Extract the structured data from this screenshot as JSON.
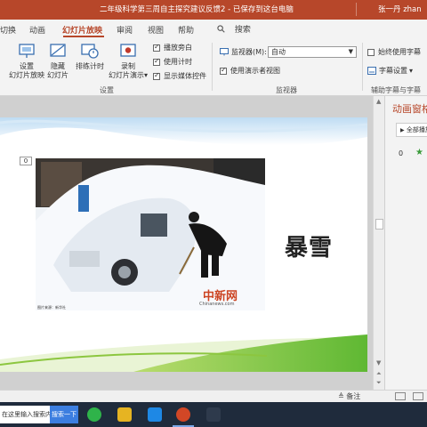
{
  "window": {
    "title": "二年级科学第三周自主探究建议反馈2 - 已保存到这台电脑",
    "user": "张一丹 zhan"
  },
  "tabs": [
    "切换",
    "动画",
    "幻灯片放映",
    "审阅",
    "视图",
    "帮助"
  ],
  "active_tab": "幻灯片放映",
  "search_label": "搜索",
  "ribbon": {
    "setup_slideshow": "设置\n幻灯片放映",
    "hide_slide": "隐藏\n幻灯片",
    "rehearse_timings": "排练计时",
    "record_slideshow": "录制\n幻灯片演示",
    "record_caret": "▾",
    "checks": [
      {
        "label": "播放旁白",
        "checked": true
      },
      {
        "label": "使用计时",
        "checked": true
      },
      {
        "label": "显示媒体控件",
        "checked": true
      }
    ],
    "setup_group": "设置",
    "monitor_label": "监视器(M):",
    "monitor_value": "自动",
    "presenter_view_label": "使用演示者视图",
    "presenter_view_checked": true,
    "monitor_group": "监视器",
    "always_subtitles": "始终使用字幕",
    "always_subtitles_checked": false,
    "subtitle_settings": "字幕设置",
    "subtitle_group": "辅助字幕与字幕"
  },
  "slide": {
    "title": "暴雪",
    "anim_tag": "0",
    "photo_watermark": "中新网",
    "photo_watermark_url": "Chinanews.com",
    "photo_caption": "图片来源：新华社"
  },
  "right_pane": {
    "title": "动画窗格",
    "play_all": "全部播放",
    "item_number": "0"
  },
  "status": {
    "notes": "备注"
  },
  "taskbar": {
    "search_placeholder": "在这里输入搜索内容",
    "search_button": "搜索一下"
  },
  "colors": {
    "accent": "#b7472a",
    "taskbar": "#1f2b3c"
  }
}
